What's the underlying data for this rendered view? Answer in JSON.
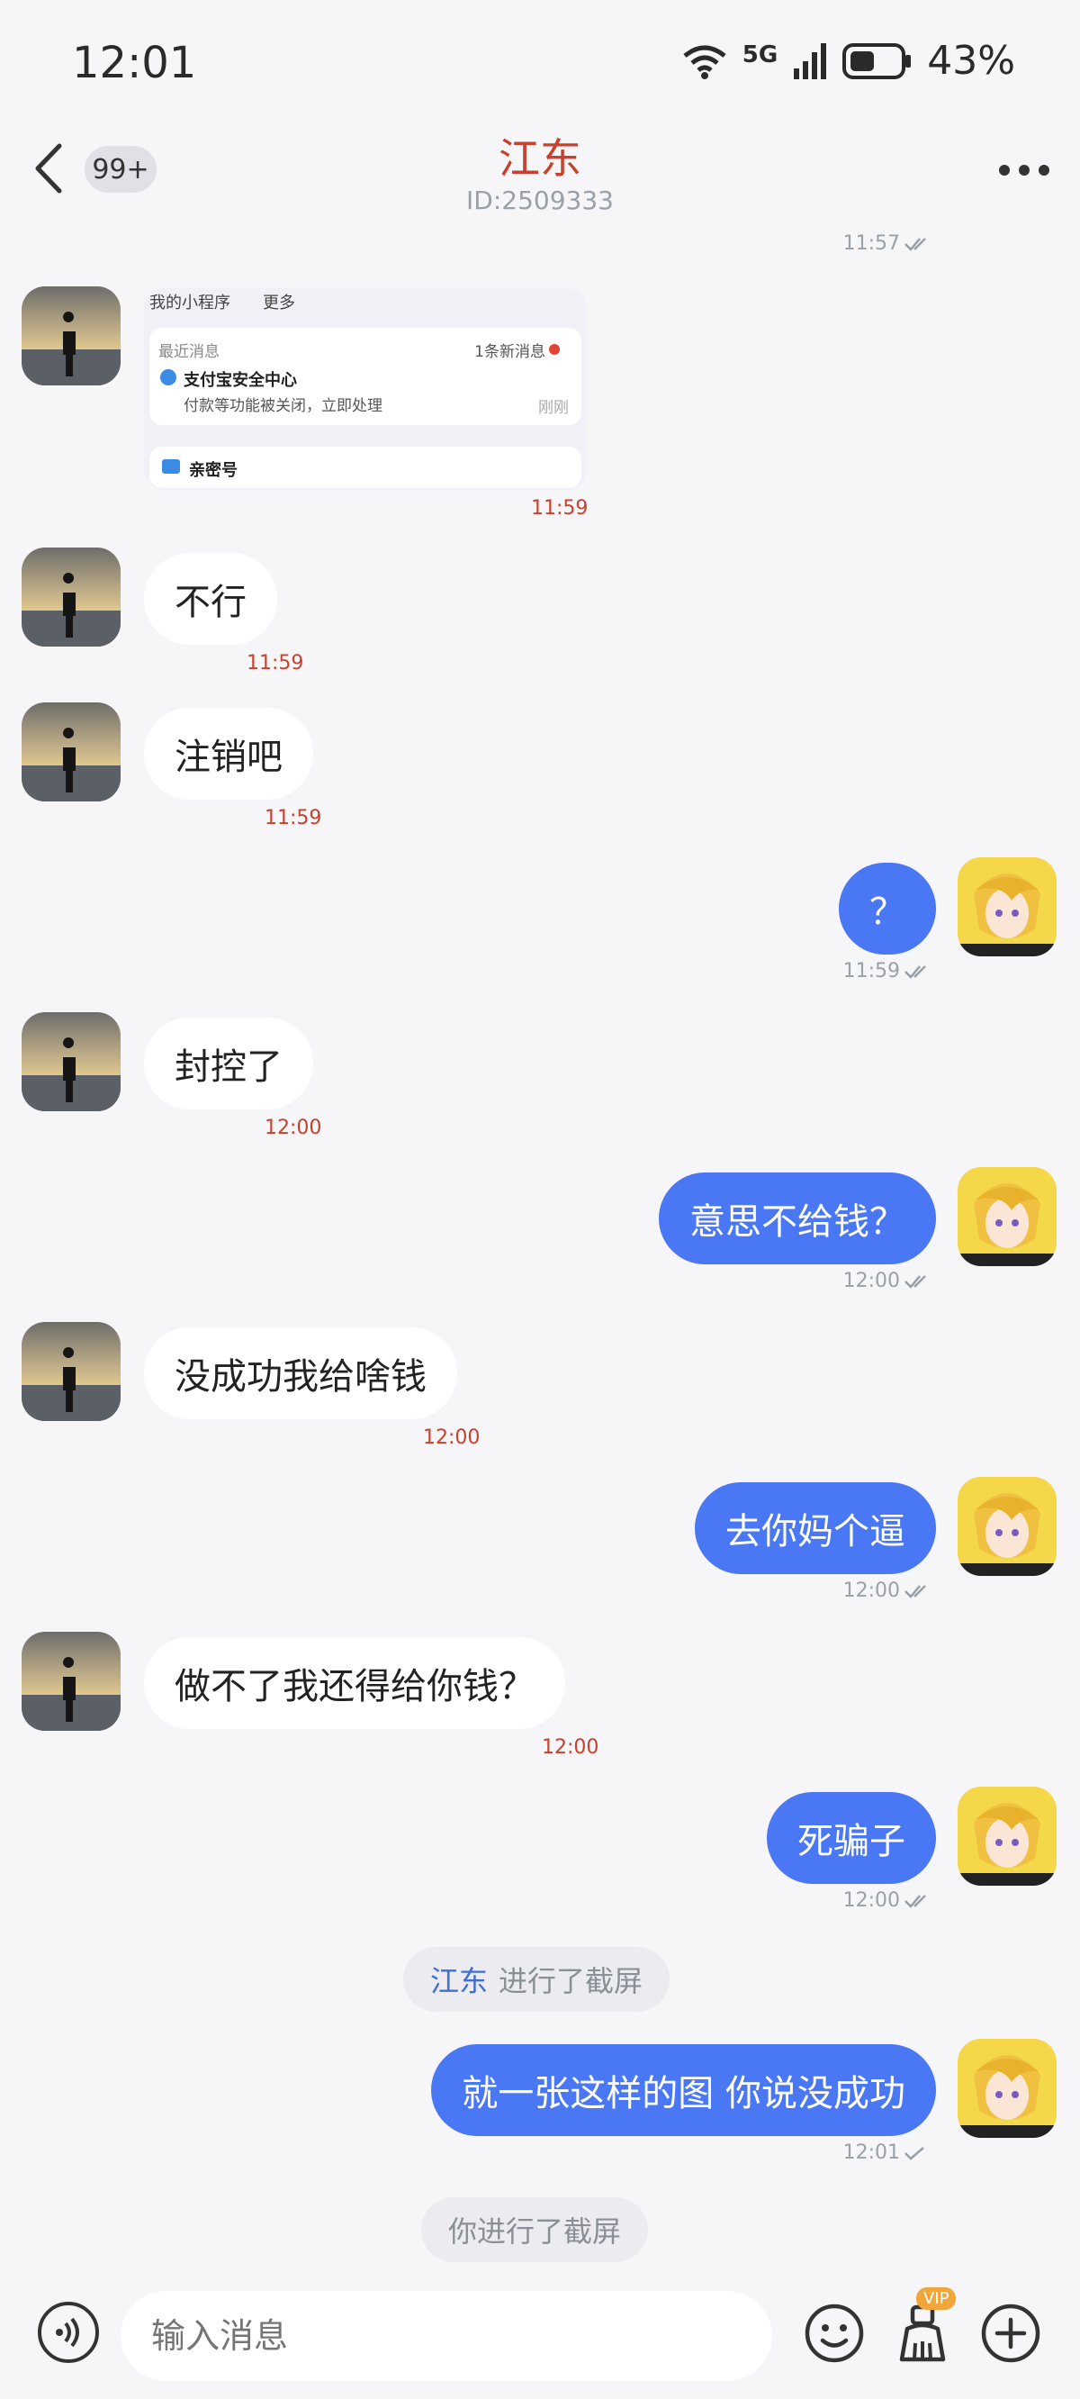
{
  "status_bar": {
    "time": "12:01",
    "network": "5G",
    "battery": "43%"
  },
  "header": {
    "unread": "99+",
    "title": "江东",
    "subtitle": "ID:2509333"
  },
  "messages": {
    "m0_time": "11:57",
    "image_card": {
      "tab1": "我的小程序",
      "tab2": "更多",
      "recent": "最近消息",
      "count": "1条新消息",
      "sender": "支付宝安全中心",
      "body": "付款等功能被关闭，立即处理",
      "when": "刚刚",
      "row2": "亲密号",
      "time": "11:59"
    },
    "m2": {
      "text": "不行",
      "time": "11:59"
    },
    "m3": {
      "text": "注销吧",
      "time": "11:59"
    },
    "m4": {
      "text": "？",
      "time": "11:59"
    },
    "m5": {
      "text": "封控了",
      "time": "12:00"
    },
    "m6": {
      "text": "意思不给钱？",
      "time": "12:00"
    },
    "m7": {
      "text": "没成功我给啥钱",
      "time": "12:00"
    },
    "m8": {
      "text": "去你妈个逼",
      "time": "12:00"
    },
    "m9": {
      "text": "做不了我还得给你钱？",
      "time": "12:00"
    },
    "m10": {
      "text": "死骗子",
      "time": "12:00"
    },
    "notice1": {
      "name": "江东",
      "text": "进行了截屏"
    },
    "m11": {
      "text": "就一张这样的图 你说没成功",
      "time": "12:01"
    },
    "notice2": {
      "text": "你进行了截屏"
    }
  },
  "input_bar": {
    "placeholder": "输入消息",
    "vip": "VIP"
  },
  "colors": {
    "accent": "#4a78f4",
    "title": "#c8402e",
    "time_red": "#c8402e"
  },
  "icons": [
    "back-icon",
    "more-icon",
    "wifi-icon",
    "signal-icon",
    "battery-icon",
    "voice-icon",
    "emoji-icon",
    "broom-icon",
    "plus-icon",
    "check-icon"
  ]
}
